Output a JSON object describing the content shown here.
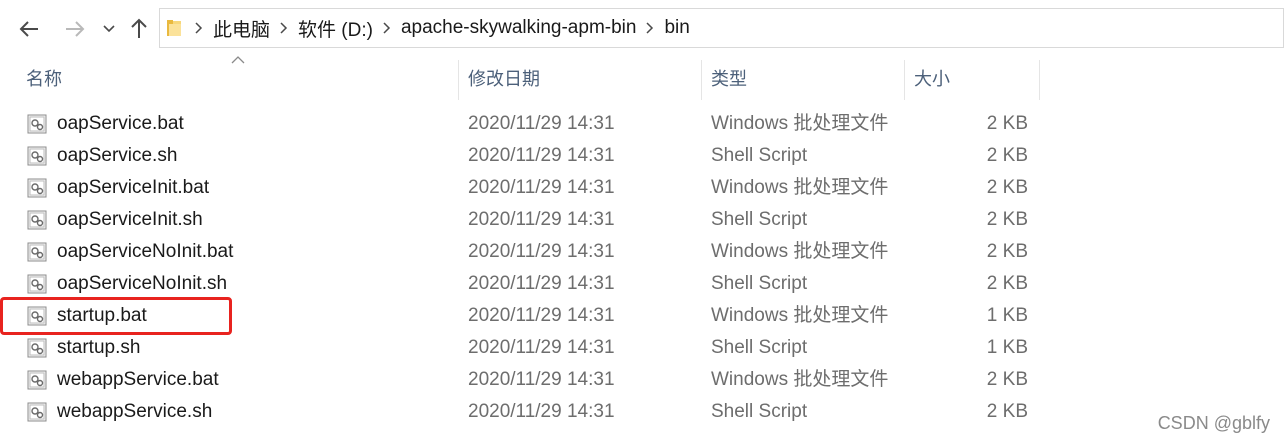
{
  "navigation": {
    "back_icon": "arrow-left-icon",
    "forward_icon": "arrow-right-icon",
    "recent_icon": "chevron-down-icon",
    "up_icon": "arrow-up-icon"
  },
  "address_bar": {
    "folder_icon": "folder-icon",
    "breadcrumbs": [
      "此电脑",
      "软件 (D:)",
      "apache-skywalking-apm-bin",
      "bin"
    ]
  },
  "columns": {
    "name": "名称",
    "date": "修改日期",
    "type": "类型",
    "size": "大小"
  },
  "files": [
    {
      "name": "oapService.bat",
      "date": "2020/11/29 14:31",
      "type": "Windows 批处理文件",
      "size": "2 KB"
    },
    {
      "name": "oapService.sh",
      "date": "2020/11/29 14:31",
      "type": "Shell Script",
      "size": "2 KB"
    },
    {
      "name": "oapServiceInit.bat",
      "date": "2020/11/29 14:31",
      "type": "Windows 批处理文件",
      "size": "2 KB"
    },
    {
      "name": "oapServiceInit.sh",
      "date": "2020/11/29 14:31",
      "type": "Shell Script",
      "size": "2 KB"
    },
    {
      "name": "oapServiceNoInit.bat",
      "date": "2020/11/29 14:31",
      "type": "Windows 批处理文件",
      "size": "2 KB"
    },
    {
      "name": "oapServiceNoInit.sh",
      "date": "2020/11/29 14:31",
      "type": "Shell Script",
      "size": "2 KB"
    },
    {
      "name": "startup.bat",
      "date": "2020/11/29 14:31",
      "type": "Windows 批处理文件",
      "size": "1 KB"
    },
    {
      "name": "startup.sh",
      "date": "2020/11/29 14:31",
      "type": "Shell Script",
      "size": "1 KB"
    },
    {
      "name": "webappService.bat",
      "date": "2020/11/29 14:31",
      "type": "Windows 批处理文件",
      "size": "2 KB"
    },
    {
      "name": "webappService.sh",
      "date": "2020/11/29 14:31",
      "type": "Shell Script",
      "size": "2 KB"
    }
  ],
  "highlighted_file": "startup.bat",
  "watermark": "CSDN @gblfy",
  "colors": {
    "highlight_border": "#e8231f",
    "header_text": "#4c607a",
    "secondary_text": "#6d6d6d"
  }
}
